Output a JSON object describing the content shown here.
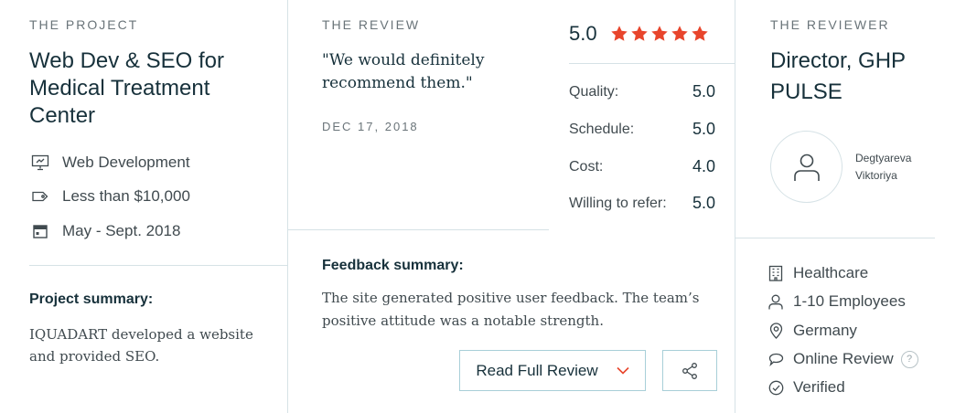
{
  "project": {
    "eyebrow": "THE PROJECT",
    "title": "Web Dev & SEO for Medical Treatment Center",
    "meta": [
      {
        "icon": "presentation-icon",
        "label": "Web Development"
      },
      {
        "icon": "price-tag-icon",
        "label": "Less than $10,000"
      },
      {
        "icon": "calendar-icon",
        "label": "May - Sept. 2018"
      }
    ],
    "summary_label": "Project summary:",
    "summary_text": "IQUADART developed a website and provided SEO."
  },
  "review": {
    "eyebrow": "THE REVIEW",
    "quote": "\"We would definitely recommend them.\"",
    "date": "DEC 17, 2018",
    "overall": "5.0",
    "stars": 5,
    "ratings": [
      {
        "label": "Quality:",
        "value": "5.0"
      },
      {
        "label": "Schedule:",
        "value": "5.0"
      },
      {
        "label": "Cost:",
        "value": "4.0"
      },
      {
        "label": "Willing to refer:",
        "value": "5.0"
      }
    ],
    "feedback_label": "Feedback summary:",
    "feedback_text": "The site generated positive user feedback. The team’s positive attitude was a notable strength.",
    "read_button": "Read Full Review"
  },
  "reviewer": {
    "eyebrow": "THE REVIEWER",
    "title": "Director, GHP PULSE",
    "name": "Degtyareva Viktoriya",
    "info": [
      {
        "icon": "building-icon",
        "label": "Healthcare"
      },
      {
        "icon": "user-icon",
        "label": "1-10 Employees"
      },
      {
        "icon": "location-pin-icon",
        "label": "Germany"
      },
      {
        "icon": "chat-bubble-icon",
        "label": "Online Review"
      },
      {
        "icon": "check-circle-icon",
        "label": "Verified"
      }
    ],
    "help_mark": "?"
  },
  "colors": {
    "star": "#e8452c",
    "chevron": "#e8452c",
    "border": "#d6e2e6",
    "button_border": "#a8cfd8"
  }
}
